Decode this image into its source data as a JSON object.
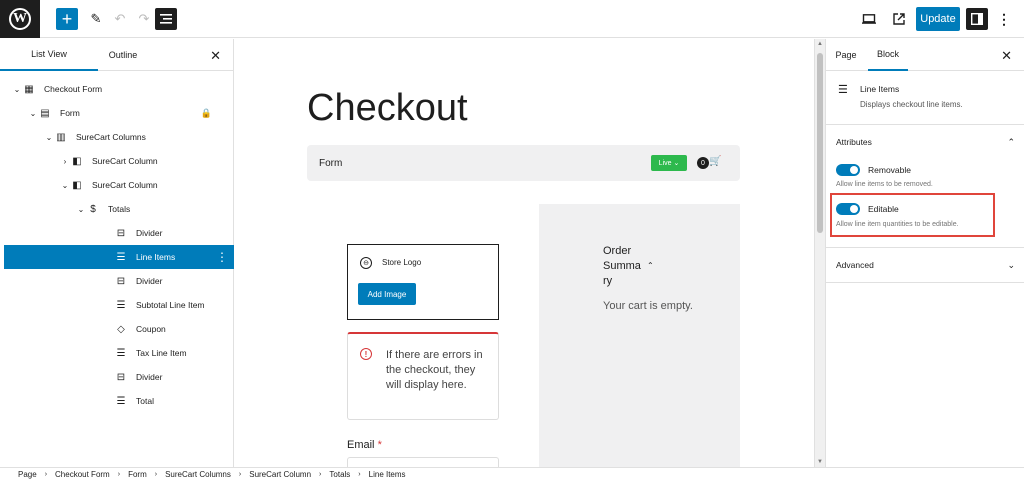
{
  "toolbar": {
    "add_symbol": "+",
    "edit_symbol": "✎",
    "undo_symbol": "↶",
    "redo_symbol": "↷",
    "listview_symbol": "☰",
    "preview_symbol": "▭",
    "viewpost_symbol": "⧉",
    "update_label": "Update",
    "settings_symbol": "◧",
    "more_symbol": "⋮"
  },
  "left_panel": {
    "tab_list": "List View",
    "tab_outline": "Outline",
    "close": "✕",
    "items": [
      {
        "label": "Checkout Form",
        "chev": "⌄",
        "icon": "▦"
      },
      {
        "label": "Form",
        "chev": "⌄",
        "icon": "▤"
      },
      {
        "label": "SureCart Columns",
        "chev": "⌄",
        "icon": "▥"
      },
      {
        "label": "SureCart Column",
        "chev": "›",
        "icon": "◧"
      },
      {
        "label": "SureCart Column",
        "chev": "⌄",
        "icon": "◧"
      },
      {
        "label": "Totals",
        "chev": "⌄",
        "icon": "$"
      },
      {
        "label": "Divider",
        "chev": "",
        "icon": "⊟"
      },
      {
        "label": "Line Items",
        "chev": "",
        "icon": "☰"
      },
      {
        "label": "Divider",
        "chev": "",
        "icon": "⊟"
      },
      {
        "label": "Subtotal Line Item",
        "chev": "",
        "icon": "☰"
      },
      {
        "label": "Coupon",
        "chev": "",
        "icon": "◇"
      },
      {
        "label": "Tax Line Item",
        "chev": "",
        "icon": "☰"
      },
      {
        "label": "Divider",
        "chev": "",
        "icon": "⊟"
      },
      {
        "label": "Total",
        "chev": "",
        "icon": "☰"
      }
    ],
    "lock_symbol": "🔒",
    "dots_symbol": "⋮"
  },
  "canvas": {
    "title": "Checkout",
    "form_label": "Form",
    "live_label": "Live ⌄",
    "cart_count": "0",
    "cart_symbol": "🛒",
    "order_summary_title": "Order Summa ry",
    "order_summary_chev": "⌃",
    "cart_empty": "Your cart is empty.",
    "store_logo_label": "Store Logo",
    "add_image_label": "Add Image",
    "error_message": "If there are errors in the checkout, they will display here.",
    "error_symbol": "!",
    "email_label": "Email",
    "email_required": " *"
  },
  "right_panel": {
    "tab_page": "Page",
    "tab_block": "Block",
    "close": "✕",
    "block_icon": "☰",
    "block_title": "Line Items",
    "block_desc": "Displays checkout line items.",
    "attributes_label": "Attributes",
    "attributes_chev": "⌃",
    "removable_label": "Removable",
    "removable_help": "Allow line items to be removed.",
    "removable_on": true,
    "editable_label": "Editable",
    "editable_help": "Allow line item quantities to be editable.",
    "editable_on": true,
    "advanced_label": "Advanced",
    "advanced_chev": "⌄"
  },
  "breadcrumb": [
    "Page",
    "Checkout Form",
    "Form",
    "SureCart Columns",
    "SureCart Column",
    "Totals",
    "Line Items"
  ],
  "breadcrumb_sep": "›",
  "colors": {
    "accent": "#007cba",
    "live": "#2db94d",
    "error": "#d63638",
    "highlight": "#e0453b"
  }
}
